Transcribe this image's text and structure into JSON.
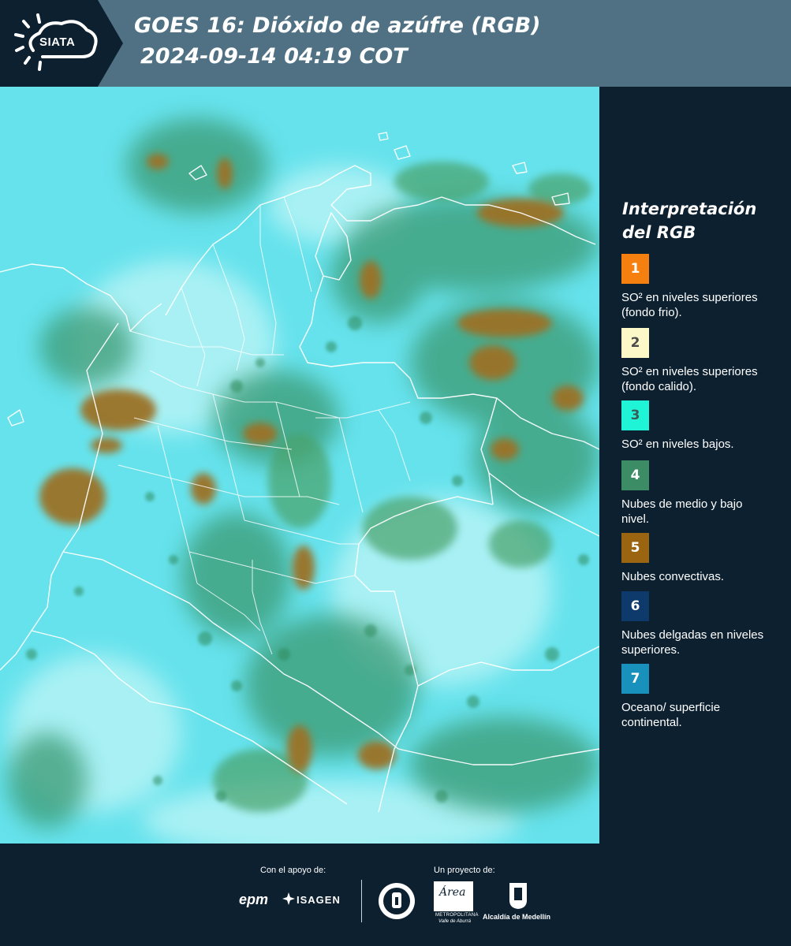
{
  "header": {
    "logo_text": "SIATA",
    "title_line1": "GOES 16: Dióxido de azúfre (RGB)",
    "title_line2": "2024-09-14 04:19 COT",
    "color_header": "#4f7183",
    "color_logo_bg": "#0d2030"
  },
  "legend": {
    "title": "Interpretación del RGB",
    "items": [
      {
        "number": "1",
        "color": "#f5800f",
        "text_color": "#ffffff",
        "label": "SO² en niveles superiores (fondo frio)."
      },
      {
        "number": "2",
        "color": "#fdf8c8",
        "text_color": "#4a4a4a",
        "label": "SO² en niveles superiores (fondo calido)."
      },
      {
        "number": "3",
        "color": "#1ff5d6",
        "text_color": "#3a5a55",
        "label": "SO² en niveles bajos."
      },
      {
        "number": "4",
        "color": "#3c8c66",
        "text_color": "#ffffff",
        "label": "Nubes de medio y bajo nivel."
      },
      {
        "number": "5",
        "color": "#9a6410",
        "text_color": "#ffffff",
        "label": "Nubes convectivas."
      },
      {
        "number": "6",
        "color": "#0e3a6b",
        "text_color": "#ffffff",
        "label": "Nubes delgadas en niveles superiores."
      },
      {
        "number": "7",
        "color": "#1891bd",
        "text_color": "#ffffff",
        "label": "Oceano/ superficie continental."
      }
    ]
  },
  "footer": {
    "support_label": "Con el apoyo de:",
    "project_label": "Un proyecto de:",
    "sponsor_epm": "epm",
    "sponsor_isagen": "ISAGEN",
    "partner_area": "Área",
    "partner_area_sub1": "METROPOLITANA",
    "partner_area_sub2": "Valle de Aburrá",
    "partner_medellin": "Alcaldía de Medellín"
  }
}
